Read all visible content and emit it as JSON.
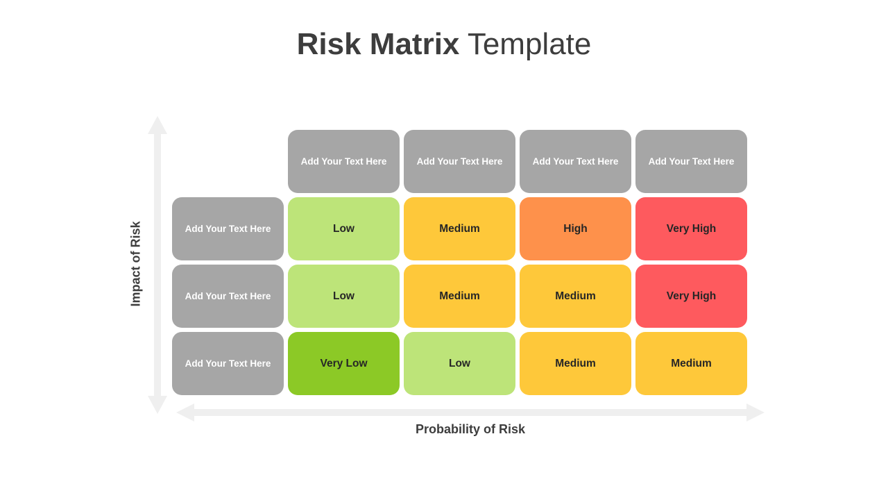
{
  "title": {
    "bold": "Risk Matrix",
    "light": "Template"
  },
  "axes": {
    "y_label": "Impact of Risk",
    "x_label": "Probability of Risk"
  },
  "colors": {
    "header": "#a6a6a6",
    "very_low": "#8cc926",
    "low": "#bde479",
    "medium": "#fec83a",
    "high": "#fe914b",
    "very_high": "#fe5a5e"
  },
  "column_headers": [
    "Add Your Text Here",
    "Add Your Text Here",
    "Add Your Text Here",
    "Add Your Text Here"
  ],
  "rows": [
    {
      "header": "Add Your Text Here",
      "cells": [
        {
          "label": "Low",
          "level": "low"
        },
        {
          "label": "Medium",
          "level": "medium"
        },
        {
          "label": "High",
          "level": "high"
        },
        {
          "label": "Very High",
          "level": "very_high"
        }
      ]
    },
    {
      "header": "Add Your Text Here",
      "cells": [
        {
          "label": "Low",
          "level": "low"
        },
        {
          "label": "Medium",
          "level": "medium"
        },
        {
          "label": "Medium",
          "level": "medium"
        },
        {
          "label": "Very High",
          "level": "very_high"
        }
      ]
    },
    {
      "header": "Add Your Text Here",
      "cells": [
        {
          "label": "Very Low",
          "level": "very_low"
        },
        {
          "label": "Low",
          "level": "low"
        },
        {
          "label": "Medium",
          "level": "medium"
        },
        {
          "label": "Medium",
          "level": "medium"
        }
      ]
    }
  ]
}
